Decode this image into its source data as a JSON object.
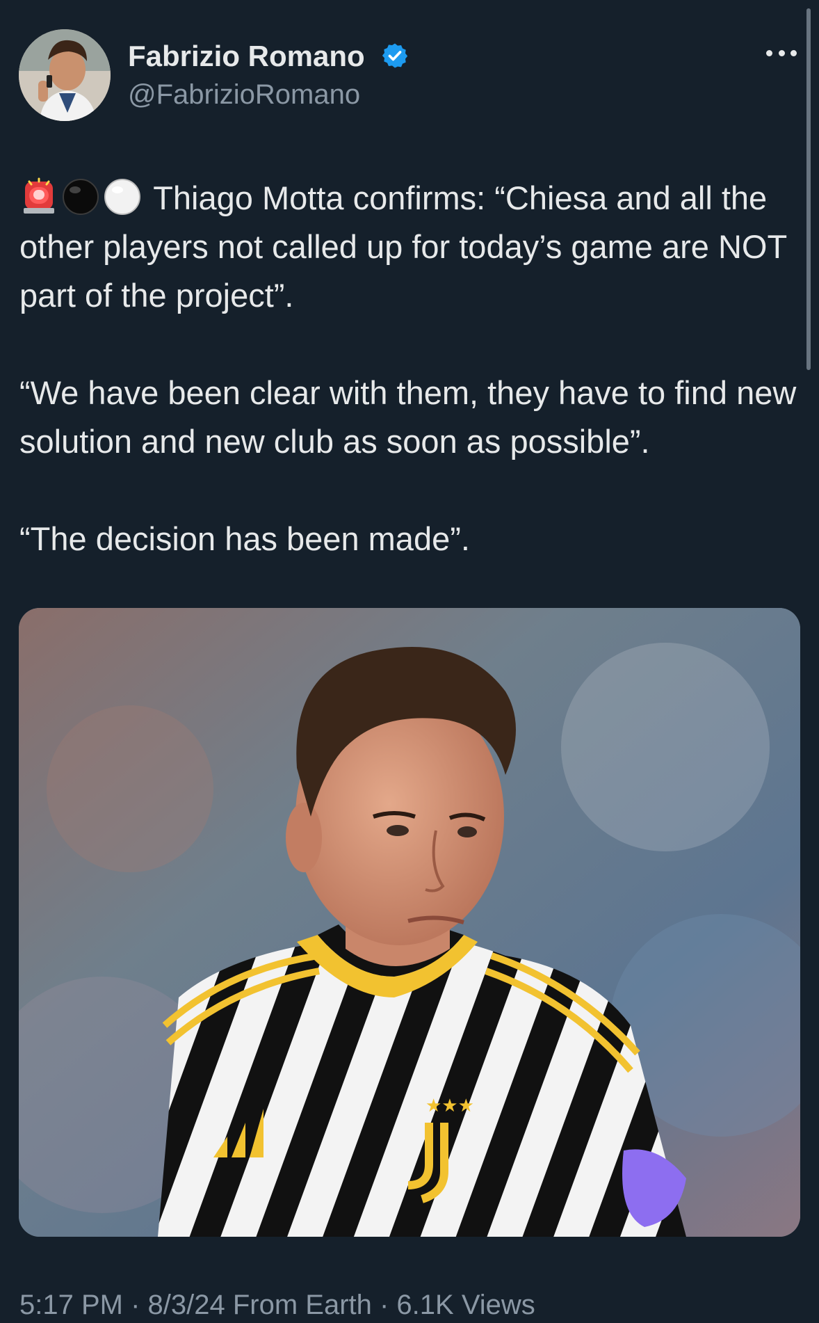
{
  "tweet": {
    "author": {
      "display_name": "Fabrizio Romano",
      "handle": "@FabrizioRomano",
      "verified": true,
      "avatar_icon": "profile-photo"
    },
    "more_icon": "more-horizontal-icon",
    "paragraphs": [
      {
        "emojis": [
          "police-light-emoji",
          "black-circle-emoji",
          "white-circle-emoji"
        ],
        "text": " Thiago Motta confirms: “Chiesa and all the other players not called up for today’s game are NOT part of the project”."
      },
      {
        "text": "“We have been clear with them, they have to find new solution and new club as soon as possible”."
      },
      {
        "text": "“The decision has been made”."
      }
    ],
    "media": {
      "type": "photo",
      "subject_icon": "football-player-photo"
    },
    "meta_line": "5:17 PM · 8/3/24 From Earth · 6.1K Views"
  },
  "colors": {
    "background": "#15202b",
    "text_primary": "#e7e9ea",
    "text_secondary": "#8b98a5",
    "verified_blue": "#1d9bf0",
    "kit_yellow": "#f2c230"
  }
}
